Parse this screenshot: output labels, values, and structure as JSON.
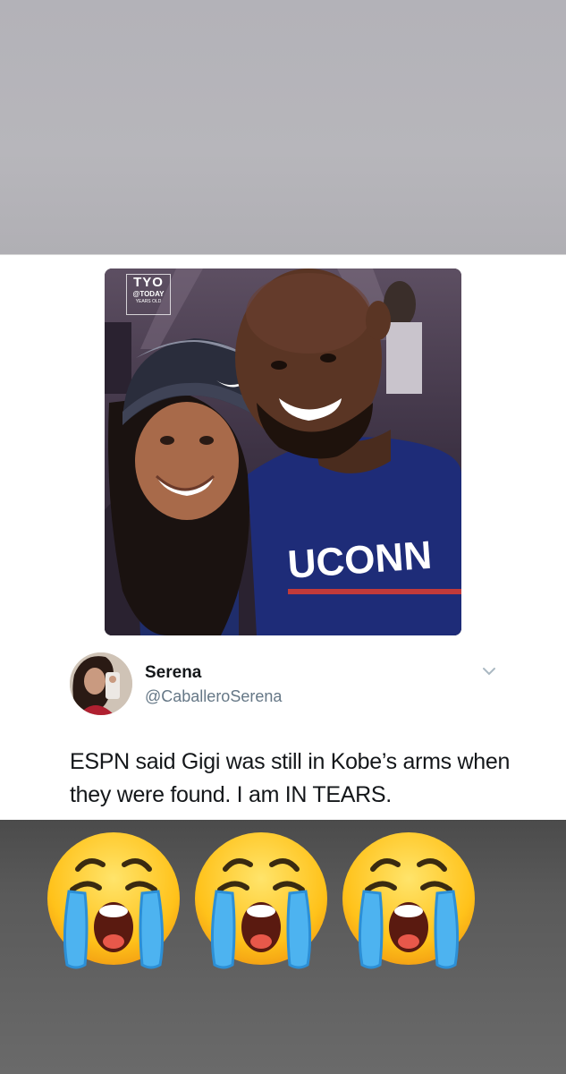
{
  "tweet": {
    "display_name": "Serena",
    "handle": "@CaballeroSerena",
    "text": "ESPN said Gigi was still in Kobe’s arms when they were found. I am IN TEARS."
  },
  "photo": {
    "watermark": {
      "line1": "TYO",
      "line2": "@TODAY",
      "line3": "YEARS OLD"
    },
    "shirt_text": "UCONN"
  },
  "overlay": {
    "emojis": [
      "loudly-crying-face",
      "loudly-crying-face",
      "loudly-crying-face"
    ]
  },
  "colors": {
    "top_band": "#b5b4b9",
    "bottom_band": "#555555",
    "name": "#14171a",
    "handle": "#657786"
  }
}
